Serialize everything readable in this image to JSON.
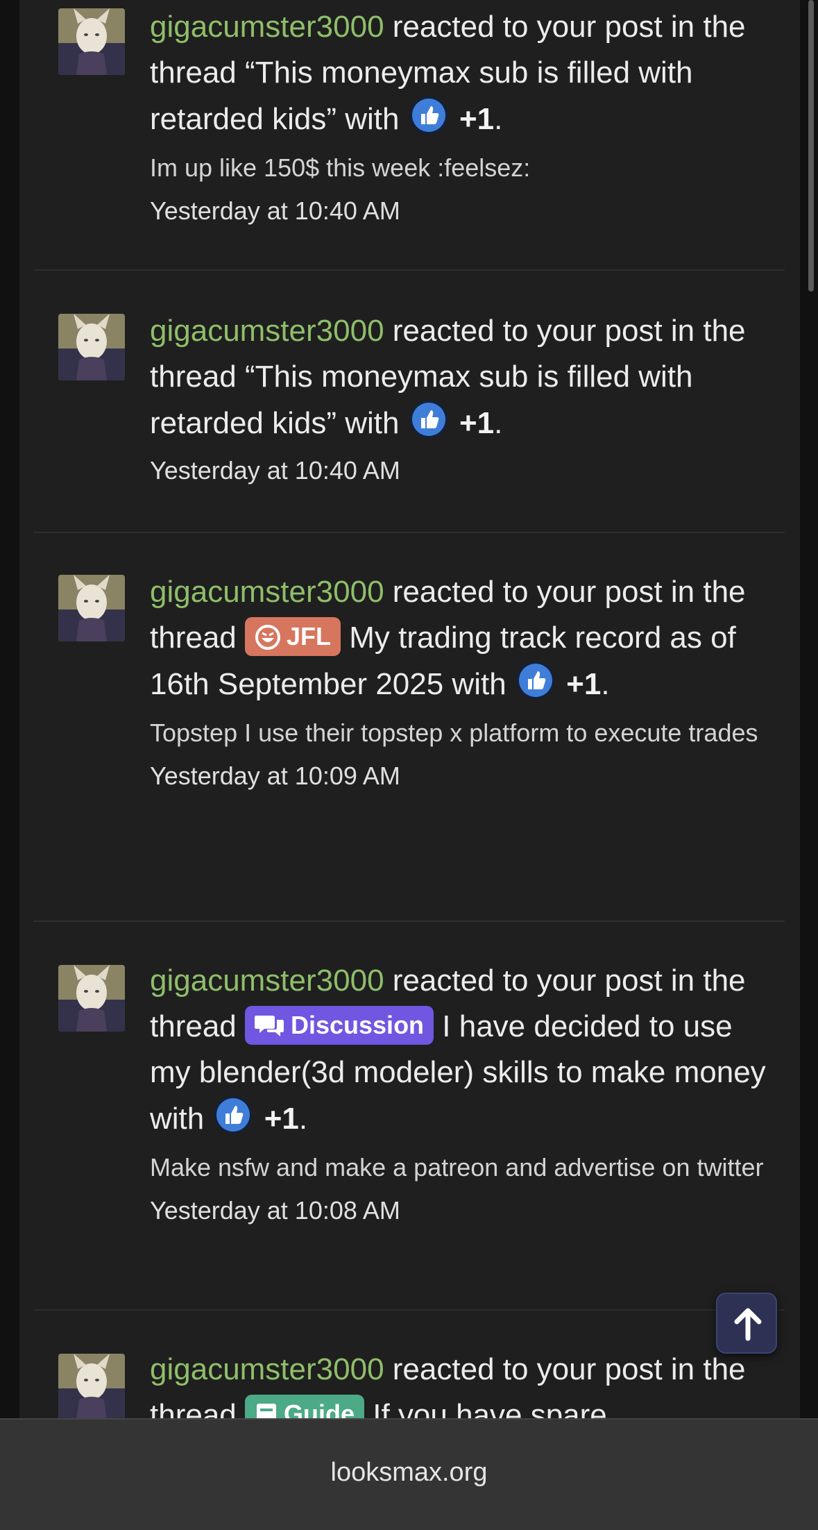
{
  "colors": {
    "username": "#8fbe6a",
    "like_blue": "#3f7ed8",
    "prefix_jfl": "#d7765e",
    "prefix_discussion": "#7056e0",
    "prefix_guide": "#4caa86",
    "background": "#1f1f1f"
  },
  "notifications": [
    {
      "user": "gigacumster3000",
      "action": "reacted to your post in the thread ",
      "thread_title": "“This moneymax sub is filled with retarded kids”",
      "with_text": " with ",
      "reaction_icon": "thumbs-up-icon",
      "reaction": "+1",
      "end": ".",
      "snippet": "Im up like 150$ this week :feelsez:",
      "time": "Yesterday at 10:40 AM"
    },
    {
      "user": "gigacumster3000",
      "action": "reacted to your post in the thread ",
      "thread_title": "“This moneymax sub is filled with retarded kids”",
      "with_text": " with ",
      "reaction_icon": "thumbs-up-icon",
      "reaction": "+1",
      "end": ".",
      "time": "Yesterday at 10:40 AM"
    },
    {
      "user": "gigacumster3000",
      "action": "reacted to your post in the thread ",
      "prefix": "JFL",
      "prefix_icon": "laughing-face-icon",
      "thread_title": "My trading track record as of 16th September 2025",
      "with_text": " with ",
      "reaction_icon": "thumbs-up-icon",
      "reaction": "+1",
      "end": ".",
      "snippet": "Topstep I use their topstep x platform to execute trades",
      "time": "Yesterday at 10:09 AM"
    },
    {
      "user": "gigacumster3000",
      "action": "reacted to your post in the thread ",
      "prefix": "Discussion",
      "prefix_icon": "comments-icon",
      "thread_title": "I have decided to use my blender(3d modeler) skills to make money",
      "with_text": " with ",
      "reaction_icon": "thumbs-up-icon",
      "reaction": "+1",
      "end": ".",
      "snippet": "Make nsfw and make a patreon and advertise on twitter",
      "time": "Yesterday at 10:08 AM"
    },
    {
      "user": "gigacumster3000",
      "action": "reacted to your post in the thread ",
      "prefix": "Guide",
      "prefix_icon": "book-icon",
      "thread_title": "If you have spare"
    }
  ],
  "back_to_top_icon": "arrow-up-icon",
  "browser": {
    "url": "looksmax.org"
  }
}
